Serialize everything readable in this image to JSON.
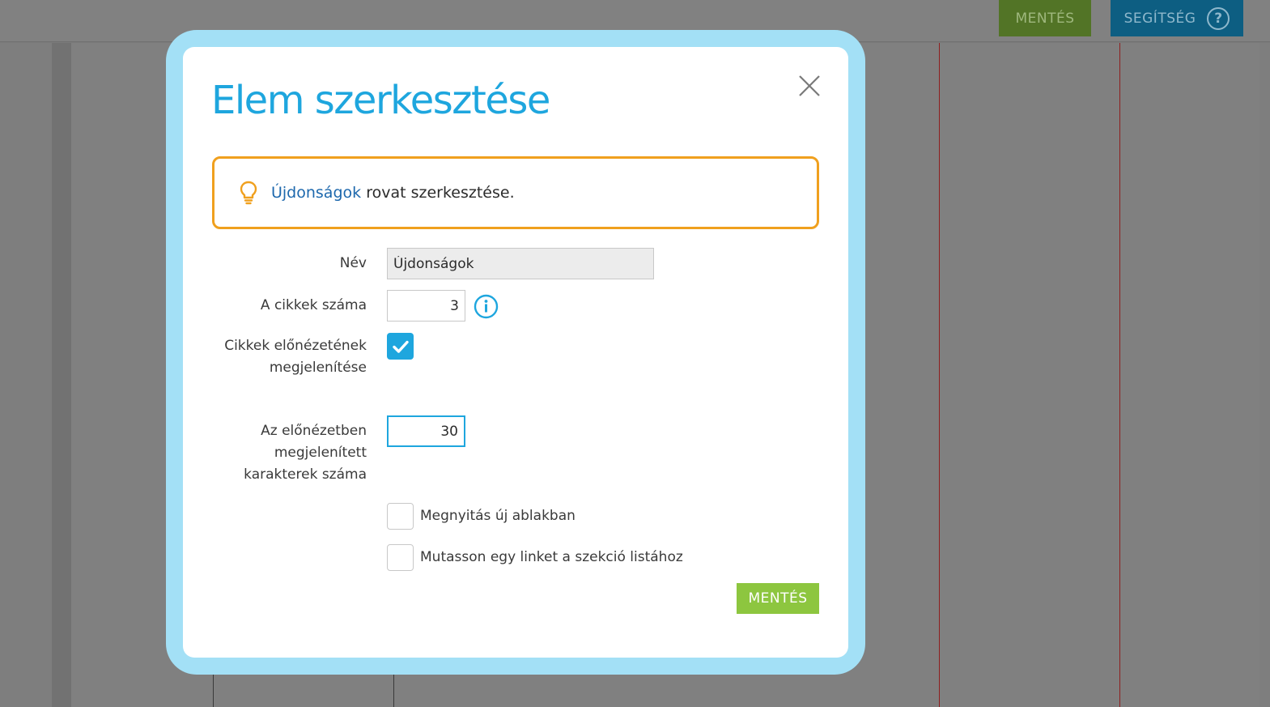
{
  "topbar": {
    "save_label": "MENTÉS",
    "help_label": "SEGÍTSÉG",
    "help_icon": "question-circle-icon"
  },
  "modal": {
    "title": "Elem szerkesztése",
    "close_icon": "close-icon",
    "info": {
      "icon": "lightbulb-icon",
      "link_text": "Újdonságok",
      "text": " rovat szerkesztése."
    },
    "fields": {
      "name_label": "Név",
      "name_value": "Újdonságok",
      "count_label": "A cikkek száma",
      "count_value": "3",
      "count_info_icon": "info-icon",
      "preview_label": "Cikkek előnézetének megjelenítése",
      "preview_checked": true,
      "preview_chars_label": "Az előnézetben megjelenített karakterek száma",
      "preview_chars_value": "30",
      "new_window_label": "Megnyitás új ablakban",
      "new_window_checked": false,
      "section_link_label": "Mutasson egy linket a szekció listához",
      "section_link_checked": false
    },
    "save_label": "MENTÉS"
  },
  "colors": {
    "accent": "#1ea6de",
    "save_green": "#8dc63f",
    "warning_border": "#f0a01e",
    "link_blue": "#1d68ad",
    "frame": "#a3e0f6"
  }
}
